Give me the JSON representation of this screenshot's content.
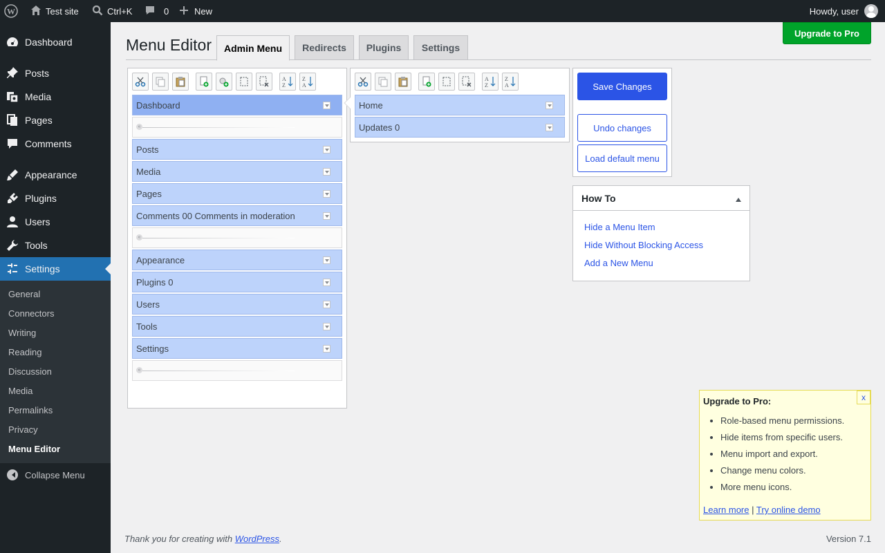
{
  "adminbar": {
    "site_name": "Test site",
    "search_shortcut": "Ctrl+K",
    "comments_count": "0",
    "new_label": "New",
    "howdy": "Howdy, user"
  },
  "sidebar": {
    "items": [
      {
        "label": "Dashboard",
        "icon": "dashboard-icon"
      },
      {
        "label": "Posts",
        "icon": "pin-icon"
      },
      {
        "label": "Media",
        "icon": "media-icon"
      },
      {
        "label": "Pages",
        "icon": "pages-icon"
      },
      {
        "label": "Comments",
        "icon": "comment-icon"
      },
      {
        "label": "Appearance",
        "icon": "brush-icon"
      },
      {
        "label": "Plugins",
        "icon": "plugin-icon"
      },
      {
        "label": "Users",
        "icon": "user-icon"
      },
      {
        "label": "Tools",
        "icon": "wrench-icon"
      },
      {
        "label": "Settings",
        "icon": "settings-icon"
      }
    ],
    "submenu": [
      "General",
      "Connectors",
      "Writing",
      "Reading",
      "Discussion",
      "Media",
      "Permalinks",
      "Privacy",
      "Menu Editor"
    ],
    "collapse": "Collapse Menu"
  },
  "main": {
    "upgrade_button": "Upgrade to Pro",
    "title": "Menu Editor",
    "tabs": [
      "Admin Menu",
      "Redirects",
      "Plugins",
      "Settings"
    ],
    "left_menu": [
      "Dashboard",
      "",
      "Posts",
      "Media",
      "Pages",
      "Comments 00 Comments in moderation",
      "",
      "Appearance",
      "Plugins 0",
      "Users",
      "Tools",
      "Settings",
      ""
    ],
    "right_menu": [
      "Home",
      "Updates 0"
    ],
    "buttons": {
      "save": "Save Changes",
      "undo": "Undo changes",
      "load_default": "Load default menu"
    },
    "howto": {
      "title": "How To",
      "links": [
        "Hide a Menu Item",
        "Hide Without Blocking Access",
        "Add a New Menu"
      ]
    },
    "pro_box": {
      "title": "Upgrade to Pro:",
      "close": "x",
      "features": [
        "Role-based menu permissions.",
        "Hide items from specific users.",
        "Menu import and export.",
        "Change menu colors.",
        "More menu icons."
      ],
      "learn_more": "Learn more",
      "separator": "|",
      "demo": "Try online demo"
    },
    "footer": {
      "thanks_prefix": "Thank you for creating with ",
      "wordpress": "WordPress",
      "thanks_suffix": ".",
      "version": "Version 7.1"
    }
  },
  "colors": {
    "accent": "#2271b1",
    "button_blue": "#2b54e6",
    "menu_item_bg": "#bdd3fb",
    "pro_green": "#00a32a"
  }
}
